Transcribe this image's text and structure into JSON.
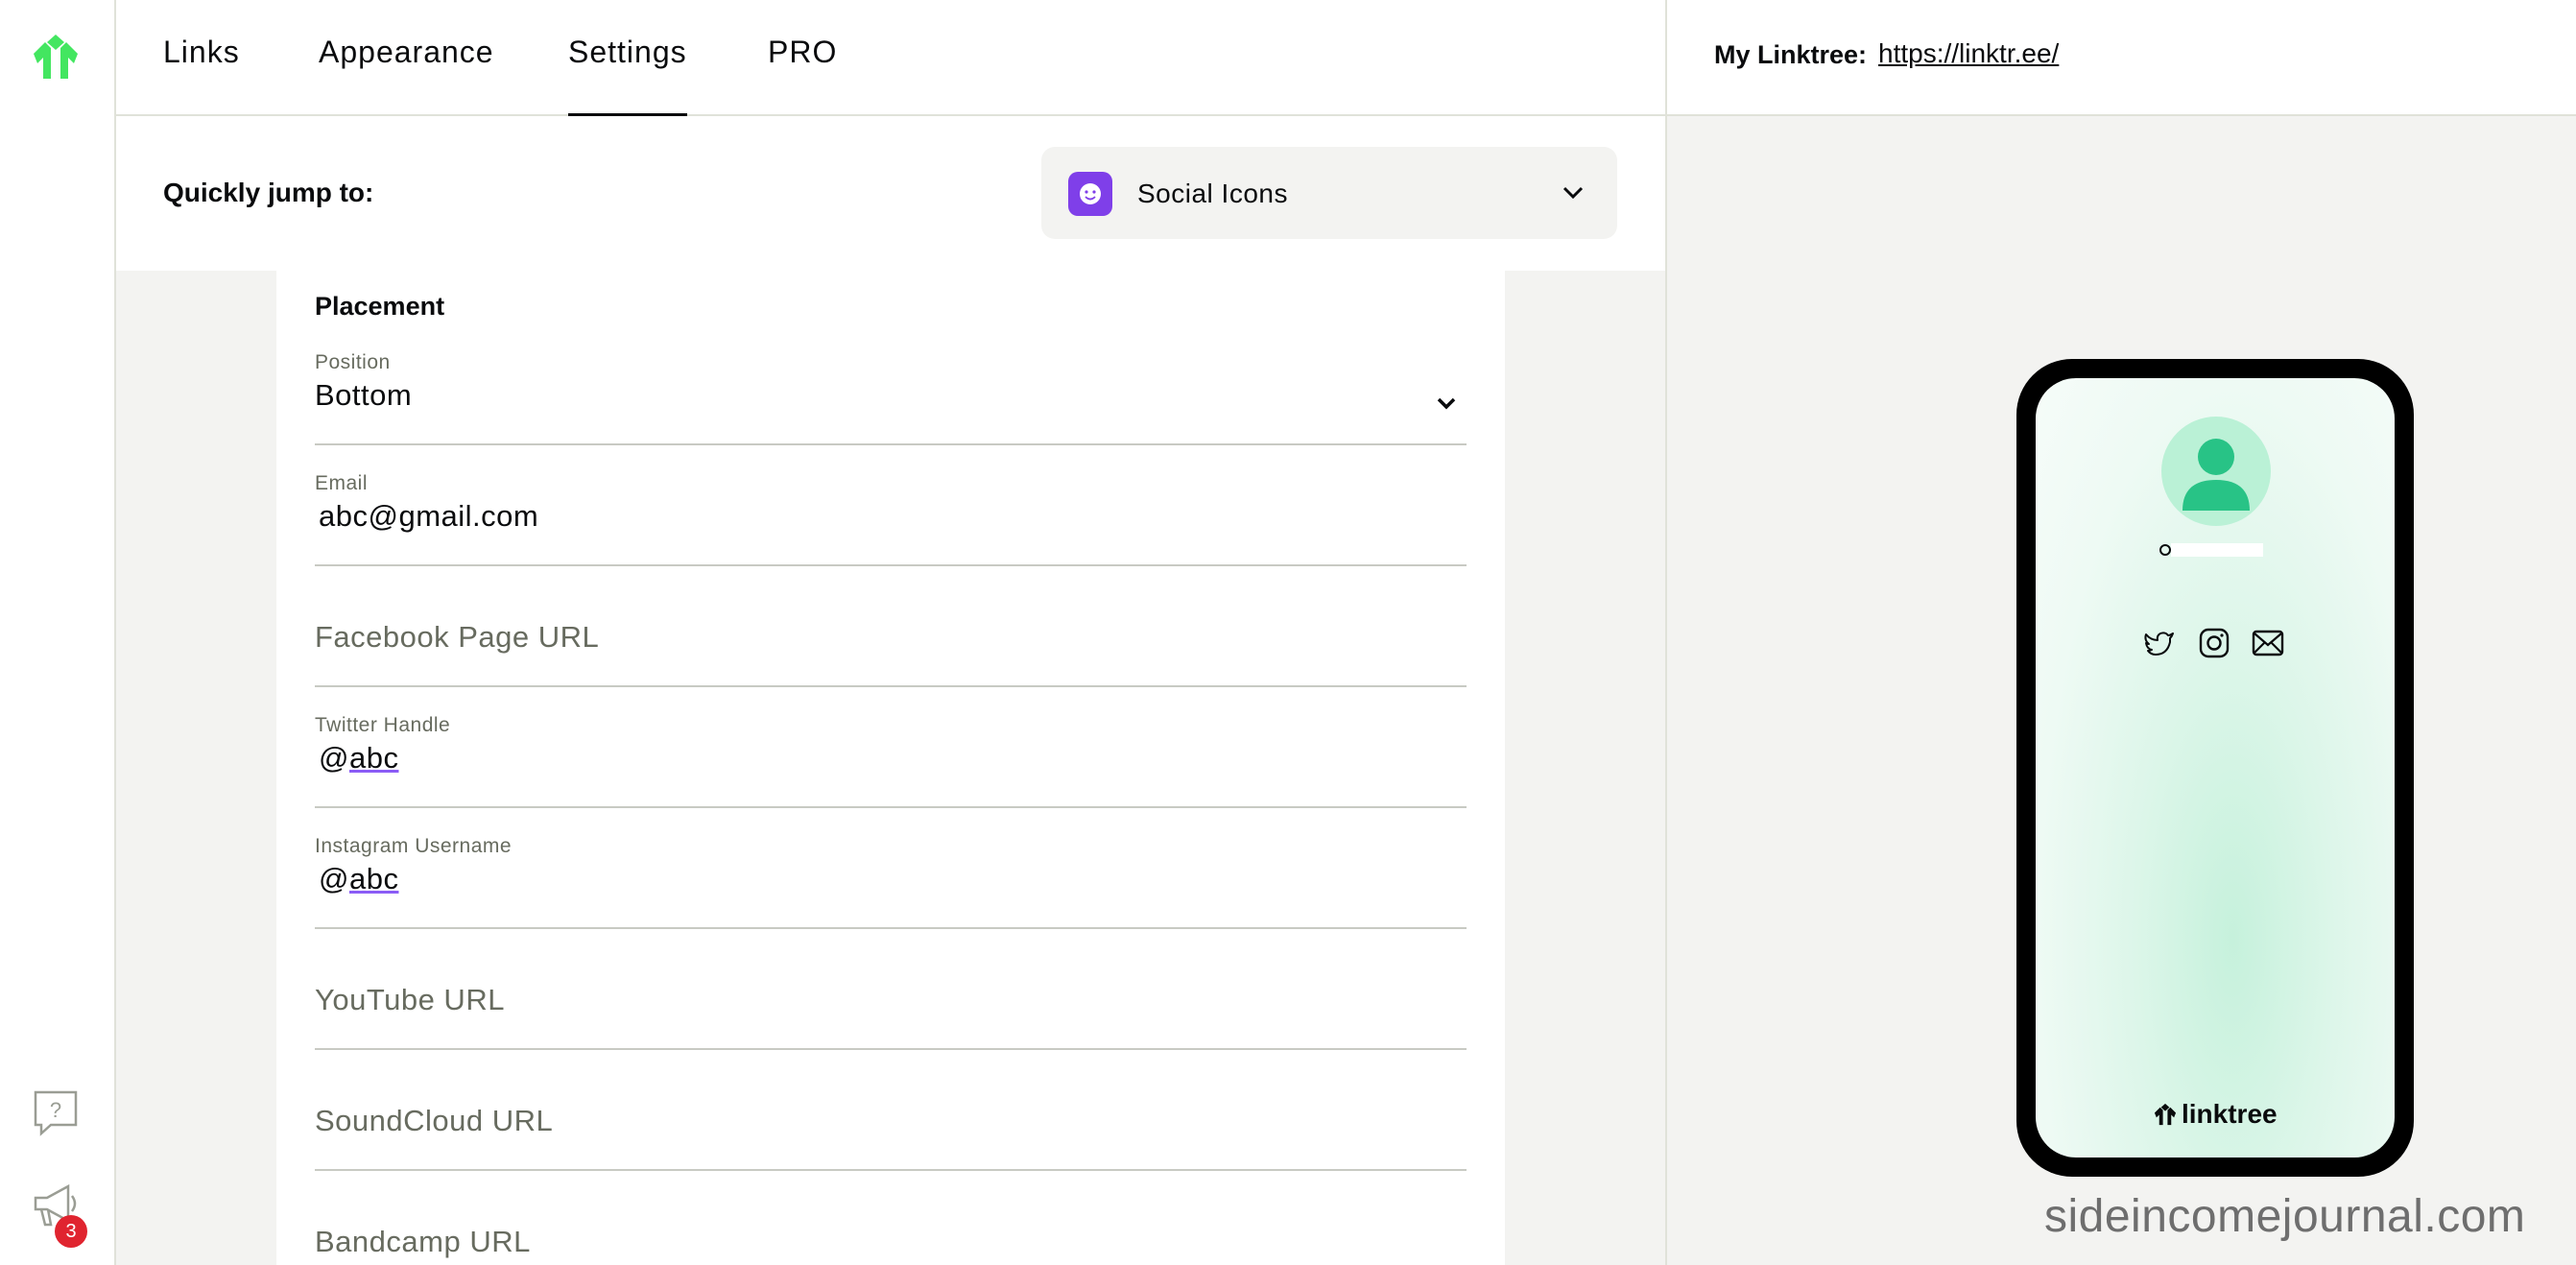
{
  "nav": {
    "tabs": [
      {
        "label": "Links"
      },
      {
        "label": "Appearance"
      },
      {
        "label": "Settings",
        "active": true
      },
      {
        "label": "PRO"
      }
    ]
  },
  "rail": {
    "logo_icon": "linktree-logo-icon",
    "help_icon": "question-bubble-icon",
    "announce_icon": "megaphone-icon",
    "notification_count": "3"
  },
  "jump": {
    "label": "Quickly jump to:",
    "selected": "Social Icons",
    "icon": "smiley-icon"
  },
  "placement": {
    "title": "Placement",
    "position_label": "Position",
    "position_value": "Bottom",
    "email_label": "Email",
    "email_value": "abc@gmail.com",
    "facebook_placeholder": "Facebook Page URL",
    "twitter_label": "Twitter Handle",
    "twitter_prefix": "@",
    "twitter_value": "abc",
    "instagram_label": "Instagram Username",
    "instagram_prefix": "@",
    "instagram_value": "abc",
    "youtube_placeholder": "YouTube URL",
    "soundcloud_placeholder": "SoundCloud URL",
    "bandcamp_placeholder": "Bandcamp URL"
  },
  "preview": {
    "label": "My Linktree:",
    "url": "https://linktr.ee/",
    "social_icons": [
      "twitter-icon",
      "instagram-icon",
      "email-icon"
    ],
    "brand": "linktree"
  },
  "colors": {
    "brand_green": "#43e660",
    "accent_purple": "#7f3fe9",
    "badge_red": "#e0242f"
  },
  "watermark": "sideincomejournal.com"
}
